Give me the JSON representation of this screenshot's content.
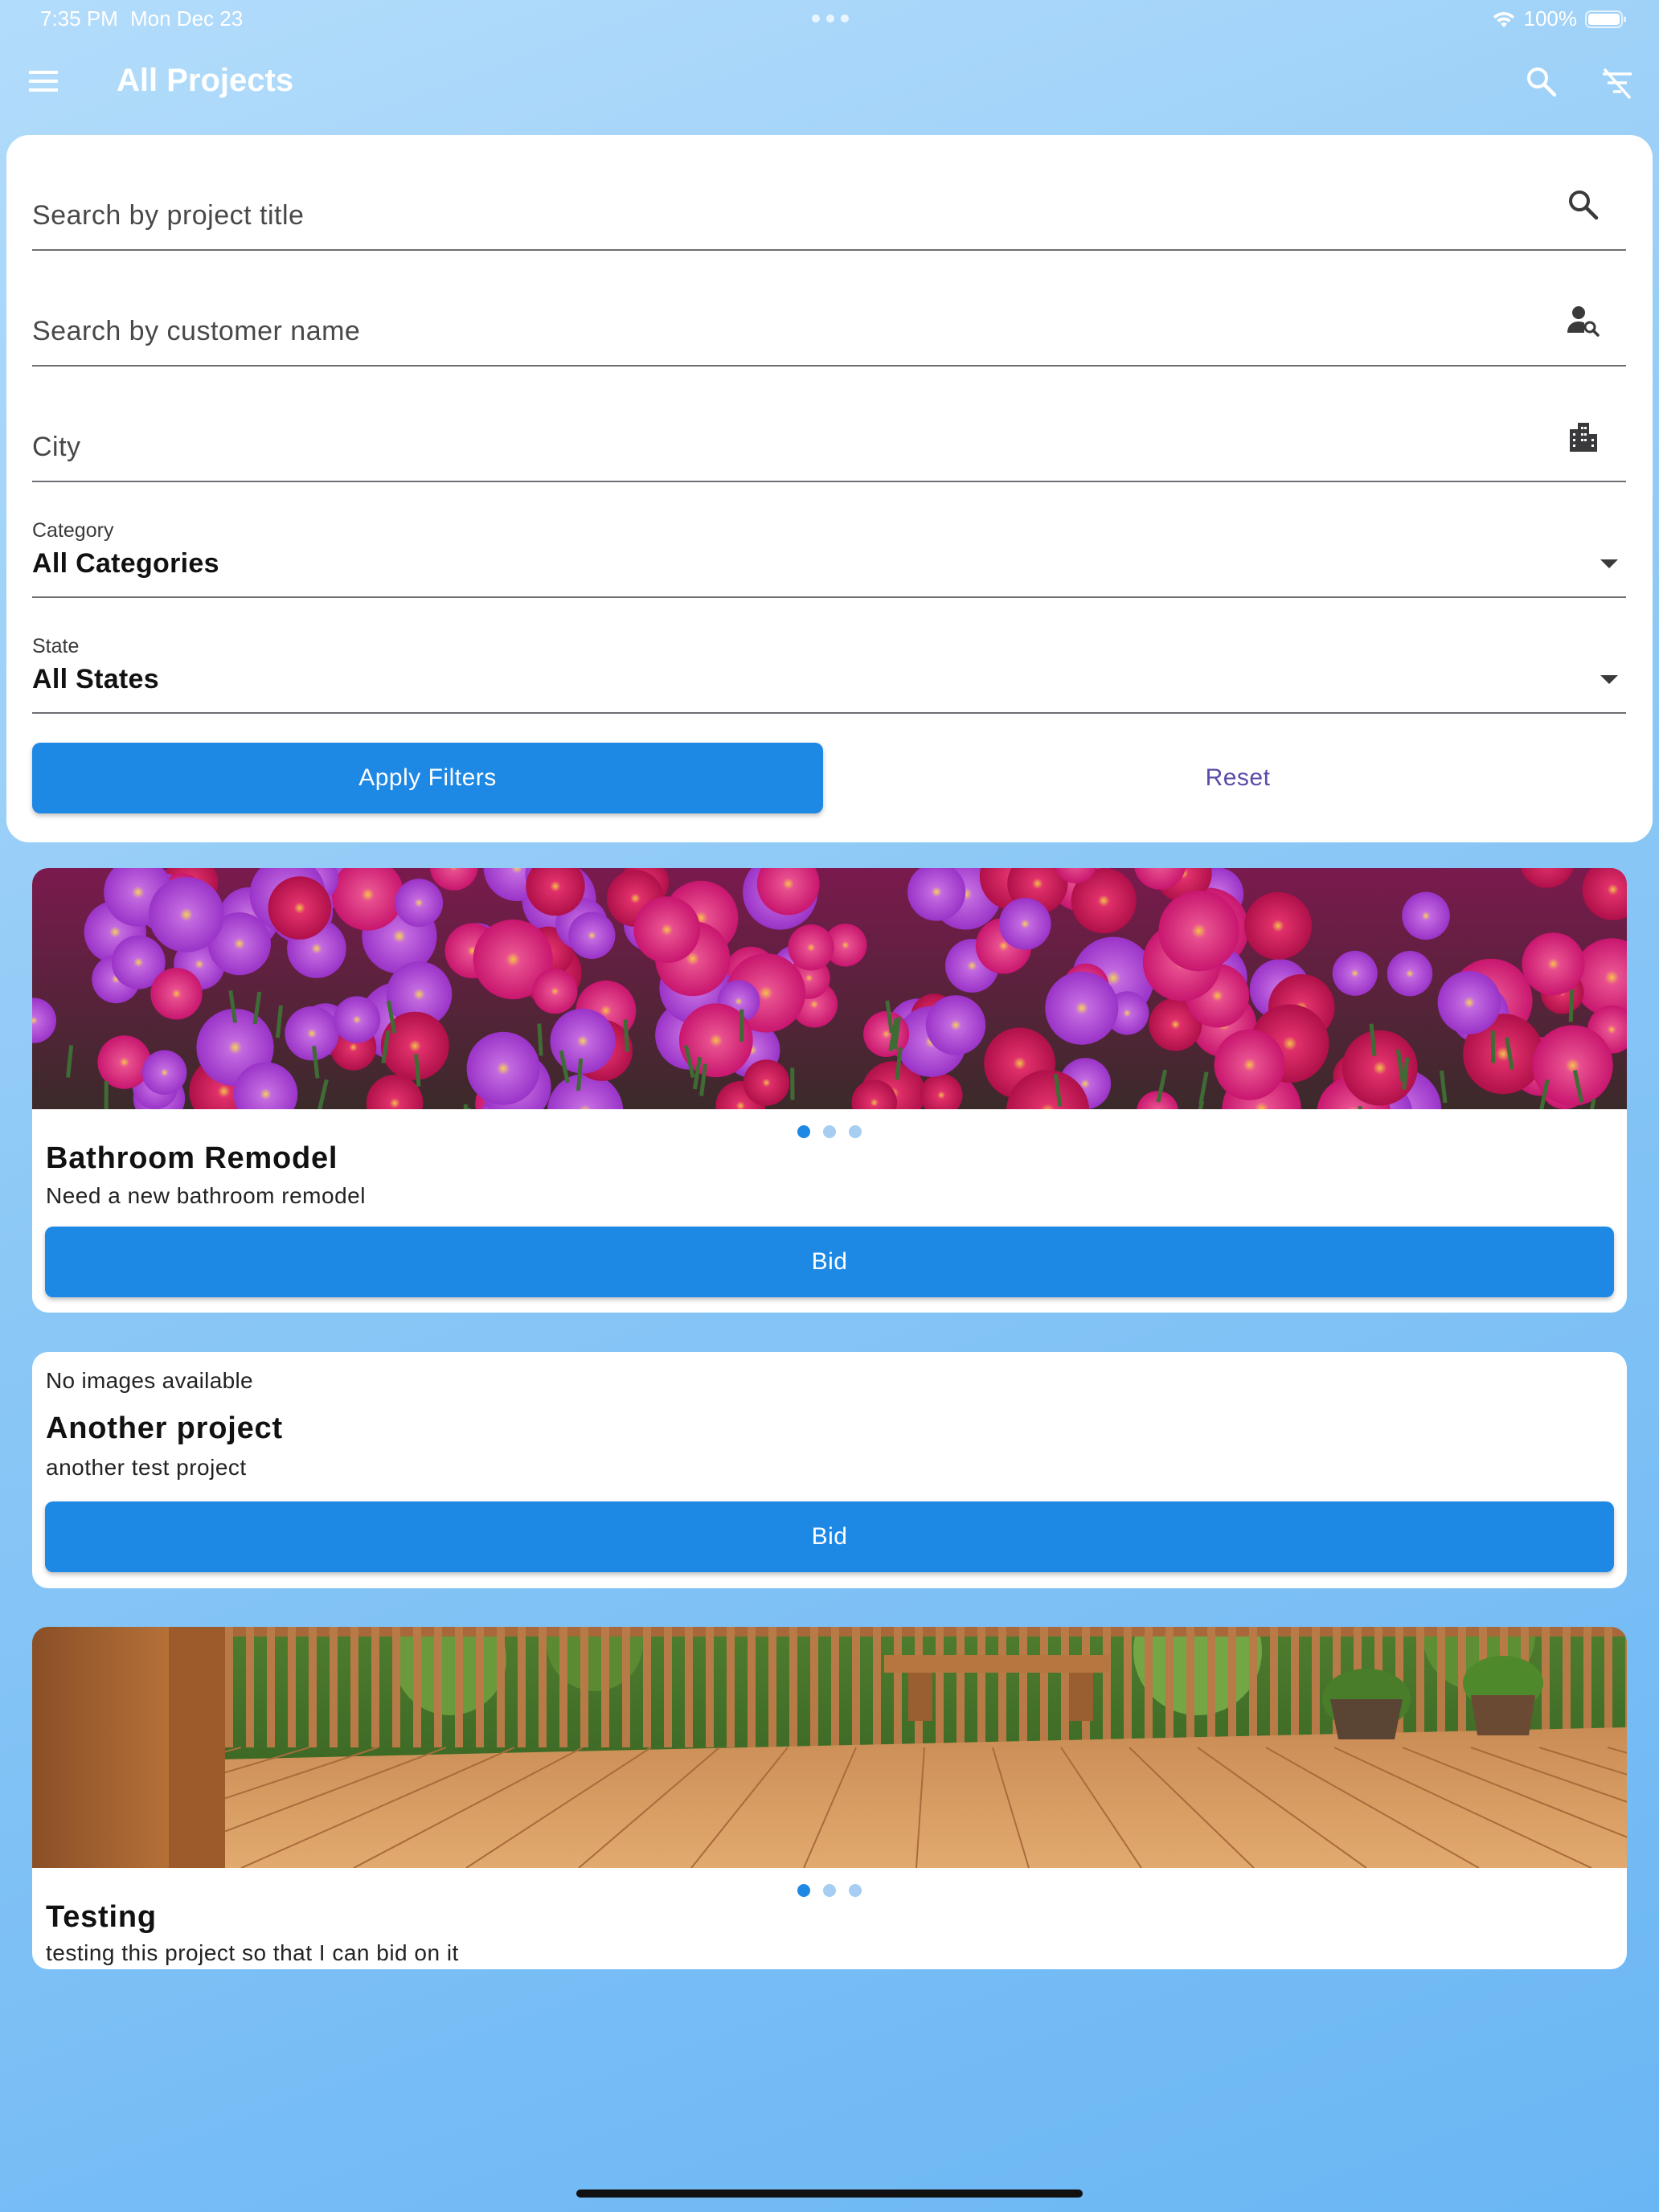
{
  "status_bar": {
    "time": "7:35 PM",
    "date": "Mon Dec 23",
    "battery": "100%"
  },
  "app_bar": {
    "title": "All Projects",
    "icons": [
      "menu-icon",
      "search-icon",
      "filter-off-icon"
    ]
  },
  "filters": {
    "project_title": {
      "placeholder": "Search by project title",
      "value": "",
      "icon": "search-icon"
    },
    "customer_name": {
      "placeholder": "Search by customer name",
      "value": "",
      "icon": "person-search-icon"
    },
    "city": {
      "placeholder": "City",
      "value": "",
      "icon": "city-icon"
    },
    "category": {
      "label": "Category",
      "value": "All Categories"
    },
    "state": {
      "label": "State",
      "value": "All States"
    },
    "apply_label": "Apply Filters",
    "reset_label": "Reset"
  },
  "projects": [
    {
      "title": "Bathroom Remodel",
      "description": "Need a new bathroom remodel",
      "image": "flowers-photo",
      "dots": 3,
      "active_dot": 0,
      "bid_label": "Bid"
    },
    {
      "note": "No images available",
      "title": "Another project",
      "description": "another test project",
      "bid_label": "Bid"
    },
    {
      "title": "Testing",
      "description": "testing this project so that I can bid on it",
      "image": "deck-photo",
      "dots": 3,
      "active_dot": 0
    }
  ],
  "colors": {
    "primary": "#1e88e5",
    "reset_text": "#5a4ba8",
    "background_top": "#b3dcfb",
    "background_bottom": "#6ab6f4"
  }
}
